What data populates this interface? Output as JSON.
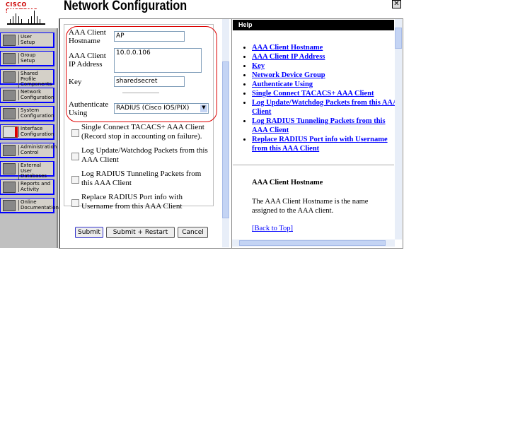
{
  "logo": {
    "text": "Cisco Systems"
  },
  "title": "Network Configuration",
  "sidebar": {
    "items": [
      {
        "label1": "User",
        "label2": "Setup"
      },
      {
        "label1": "Group",
        "label2": "Setup"
      },
      {
        "label1": "Shared Profile",
        "label2": "Components"
      },
      {
        "label1": "Network",
        "label2": "Configuration"
      },
      {
        "label1": "System",
        "label2": "Configuration"
      },
      {
        "label1": "Interface",
        "label2": "Configuration"
      },
      {
        "label1": "Administration",
        "label2": "Control"
      },
      {
        "label1": "External User",
        "label2": "Databases"
      },
      {
        "label1": "Reports and",
        "label2": "Activity"
      },
      {
        "label1": "Online",
        "label2": "Documentation"
      }
    ]
  },
  "form": {
    "hostname_label": "AAA Client Hostname",
    "hostname_value": "AP",
    "ip_label": "AAA Client IP Address",
    "ip_value": "10.0.0.106",
    "key_label": "Key",
    "key_value": "sharedsecret",
    "auth_label": "Authenticate Using",
    "auth_value": "RADIUS (Cisco IOS/PIX)",
    "checkboxes": [
      {
        "label": "Single Connect TACACS+ AAA Client (Record stop in accounting on failure).",
        "checked": false
      },
      {
        "label": "Log Update/Watchdog Packets from this AAA Client",
        "checked": false
      },
      {
        "label": "Log RADIUS Tunneling Packets from this AAA Client",
        "checked": false
      },
      {
        "label": "Replace RADIUS Port info with Username from this AAA Client",
        "checked": false
      }
    ],
    "submit": "Submit",
    "submit_restart": "Submit + Restart",
    "cancel": "Cancel"
  },
  "help": {
    "header": "Help",
    "links": [
      "AAA Client Hostname",
      "AAA Client IP Address",
      "Key",
      "Network Device Group",
      "Authenticate Using",
      "Single Connect TACACS+ AAA Client",
      "Log Update/Watchdog Packets from this AAA Client",
      "Log RADIUS Tunneling Packets from this AAA Client",
      "Replace RADIUS Port info with Username from this AAA Client"
    ],
    "section_title": "AAA Client Hostname",
    "section_text": "The AAA Client Hostname is the name assigned to the AAA client.",
    "back_to_top": "[Back to Top]"
  }
}
